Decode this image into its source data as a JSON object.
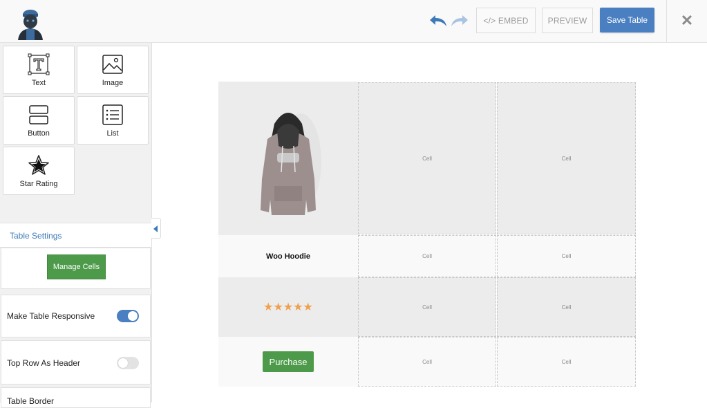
{
  "header": {
    "embed_label": "</> EMBED",
    "preview_label": "PREVIEW",
    "save_label": "Save Table",
    "close_label": "✕",
    "accent_color": "#4a7fc1"
  },
  "elements": [
    {
      "label": "Text",
      "icon": "text-icon"
    },
    {
      "label": "Image",
      "icon": "image-icon"
    },
    {
      "label": "Button",
      "icon": "button-icon"
    },
    {
      "label": "List",
      "icon": "list-icon"
    },
    {
      "label": "Star Rating",
      "icon": "star-icon"
    }
  ],
  "settings": {
    "title": "Table Settings",
    "manage_cells": "Manage Cells",
    "responsive_label": "Make Table Responsive",
    "responsive_on": true,
    "top_row_header_label": "Top Row As Header",
    "top_row_header_on": false,
    "table_border_label": "Table Border"
  },
  "table": {
    "product_name": "Woo Hoodie",
    "stars": "★★★★★",
    "purchase_label": "Purchase",
    "cell_placeholder": "Cell",
    "star_color": "#f0a04b",
    "button_color": "#4d9a4a"
  }
}
